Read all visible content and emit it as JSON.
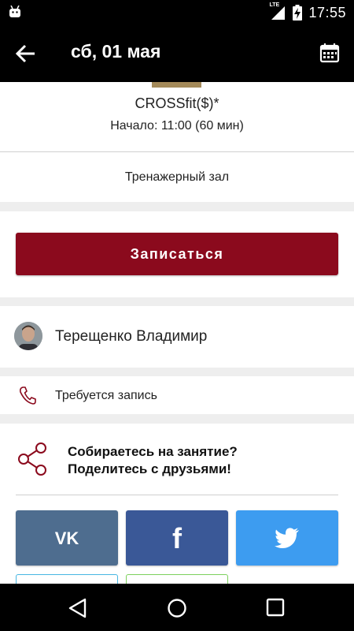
{
  "status_bar": {
    "time": "17:55",
    "network": "LTE"
  },
  "toolbar": {
    "title": "сб, 01 мая"
  },
  "class": {
    "name": "CROSSfit($)*",
    "time": "Начало: 11:00 (60 мин)",
    "location": "Тренажерный зал"
  },
  "signup": {
    "label": "Записаться"
  },
  "trainer": {
    "name": "Терещенко Владимир"
  },
  "requirement": {
    "text": "Требуется запись"
  },
  "share": {
    "line1": "Собираетесь на занятие?",
    "line2": "Поделитесь с друзьями!"
  },
  "social": {
    "vk": {
      "label": "VK",
      "color": "#4e6d8f"
    },
    "facebook": {
      "label": "f",
      "color": "#3a5897"
    },
    "twitter": {
      "icon": "twitter-bird-icon",
      "color": "#3d9cf0"
    }
  },
  "colors": {
    "accent": "#8b0a1d",
    "header": "#000000"
  }
}
